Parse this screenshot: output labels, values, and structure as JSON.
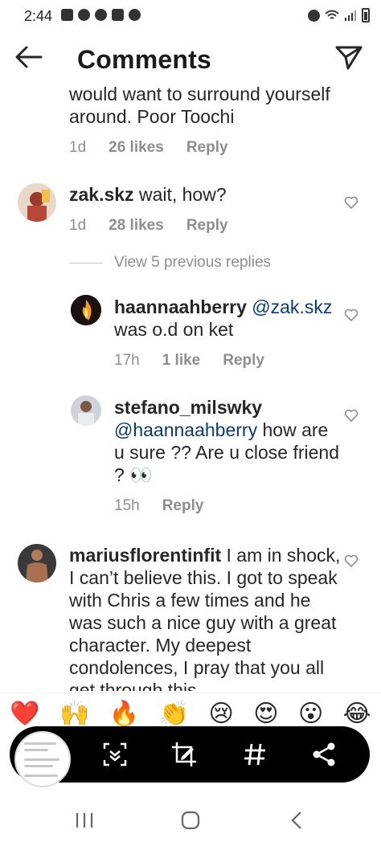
{
  "status_bar": {
    "time": "2:44"
  },
  "header": {
    "title": "Comments"
  },
  "comments": [
    {
      "text": "would want to surround yourself around. Poor Toochi",
      "time": "1d",
      "likes": "26 likes",
      "reply": "Reply"
    },
    {
      "username": "zak.skz",
      "text": " wait, how?",
      "time": "1d",
      "likes": "28 likes",
      "reply": "Reply"
    }
  ],
  "view_replies": "View 5 previous replies",
  "replies": [
    {
      "username": "haannaahberry",
      "mention": "@zak.skz",
      "text": "was o.d on ket",
      "time": "17h",
      "likes": "1 like",
      "reply": "Reply"
    },
    {
      "username": "stefano_milswky",
      "mention": "@haannaahberry",
      "text": " how are u sure ?? Are u close friend ? 👀",
      "time": "15h",
      "reply": "Reply"
    }
  ],
  "last_comment": {
    "username": "mariusflorentinfit",
    "text": " I am in shock, I can’t believe this. I got to speak with Chris a few times and he was such a nice guy with a great character. My deepest condolences, I pray that you all get through this"
  },
  "reactions": [
    "❤️",
    "🙌",
    "🔥",
    "👏",
    "😢",
    "😍",
    "😮",
    "😂"
  ],
  "toolbar": {
    "buttons": [
      "scroll-capture-icon",
      "crop-edit-icon",
      "hashtag-icon",
      "share-icon"
    ]
  },
  "colors": {
    "mention": "#0d3a6e",
    "meta": "#8e8e8e",
    "toolbar": "#000000"
  }
}
